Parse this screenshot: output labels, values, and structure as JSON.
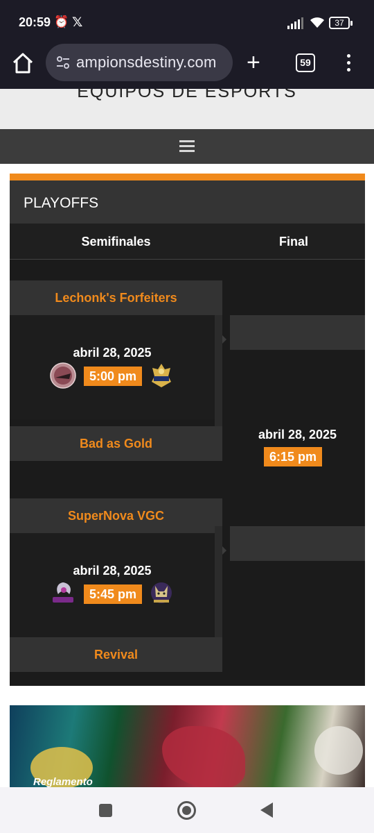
{
  "status_bar": {
    "time": "20:59",
    "battery": "37"
  },
  "browser": {
    "url": "ampionsdestiny.com",
    "tab_count": "59"
  },
  "site": {
    "title": "EQUIPOS DE ESPORTS"
  },
  "playoffs": {
    "title": "PLAYOFFS",
    "rounds": [
      "Semifinales",
      "Final"
    ],
    "accent_color": "#f08a1c",
    "matches": [
      {
        "team_top": "Lechonk's Forfeiters",
        "team_bottom": "Bad as Gold",
        "date": "abril 28, 2025",
        "time": "5:00 pm",
        "logo_top_icon": "lechonk-forfeiters-logo-icon",
        "logo_bottom_icon": "bad-as-gold-logo-icon"
      },
      {
        "team_top": "SuperNova VGC",
        "team_bottom": "Revival",
        "date": "abril 28, 2025",
        "time": "5:45 pm",
        "logo_top_icon": "supernova-vgc-logo-icon",
        "logo_bottom_icon": "revival-logo-icon"
      }
    ],
    "final": {
      "date": "abril 28, 2025",
      "time": "6:15 pm"
    }
  },
  "banner": {
    "text": "Reglamento"
  }
}
